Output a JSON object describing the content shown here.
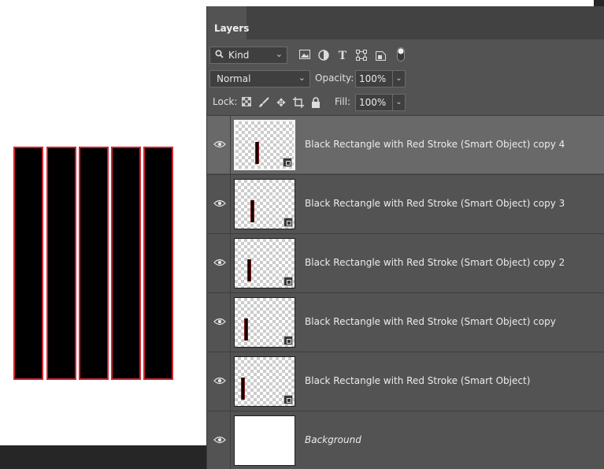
{
  "canvas": {
    "rect_fill": "#000000",
    "rect_stroke": "#d2232c",
    "rect_count": 5
  },
  "panel": {
    "tab_label": "Layers",
    "filter": {
      "kind_label": "Kind",
      "icons": [
        "image-filter-icon",
        "adjustment-filter-icon",
        "type-filter-icon",
        "shape-filter-icon",
        "smart-object-filter-icon",
        "filter-toggle-icon"
      ]
    },
    "blend_mode": "Normal",
    "opacity_label": "Opacity:",
    "opacity_value": "100%",
    "lock_label": "Lock:",
    "lock_icons": [
      "lock-transparent-pixels-icon",
      "lock-image-pixels-icon",
      "lock-position-icon",
      "lock-artboard-icon",
      "lock-all-icon"
    ],
    "fill_label": "Fill:",
    "fill_value": "100%"
  },
  "layers": [
    {
      "name": "Black Rectangle with Red Stroke (Smart Object) copy 4",
      "selected": true,
      "visible": true,
      "smart_object": true,
      "bar_pos": 0.33
    },
    {
      "name": "Black Rectangle with Red Stroke (Smart Object) copy 3",
      "selected": false,
      "visible": true,
      "smart_object": true,
      "bar_pos": 0.27
    },
    {
      "name": "Black Rectangle with Red Stroke (Smart Object) copy 2",
      "selected": false,
      "visible": true,
      "smart_object": true,
      "bar_pos": 0.22
    },
    {
      "name": "Black Rectangle with Red Stroke (Smart Object) copy",
      "selected": false,
      "visible": true,
      "smart_object": true,
      "bar_pos": 0.17
    },
    {
      "name": "Black Rectangle with Red Stroke (Smart Object)",
      "selected": false,
      "visible": true,
      "smart_object": true,
      "bar_pos": 0.12
    },
    {
      "name": "Background",
      "selected": false,
      "visible": true,
      "smart_object": false,
      "italic": true
    }
  ]
}
